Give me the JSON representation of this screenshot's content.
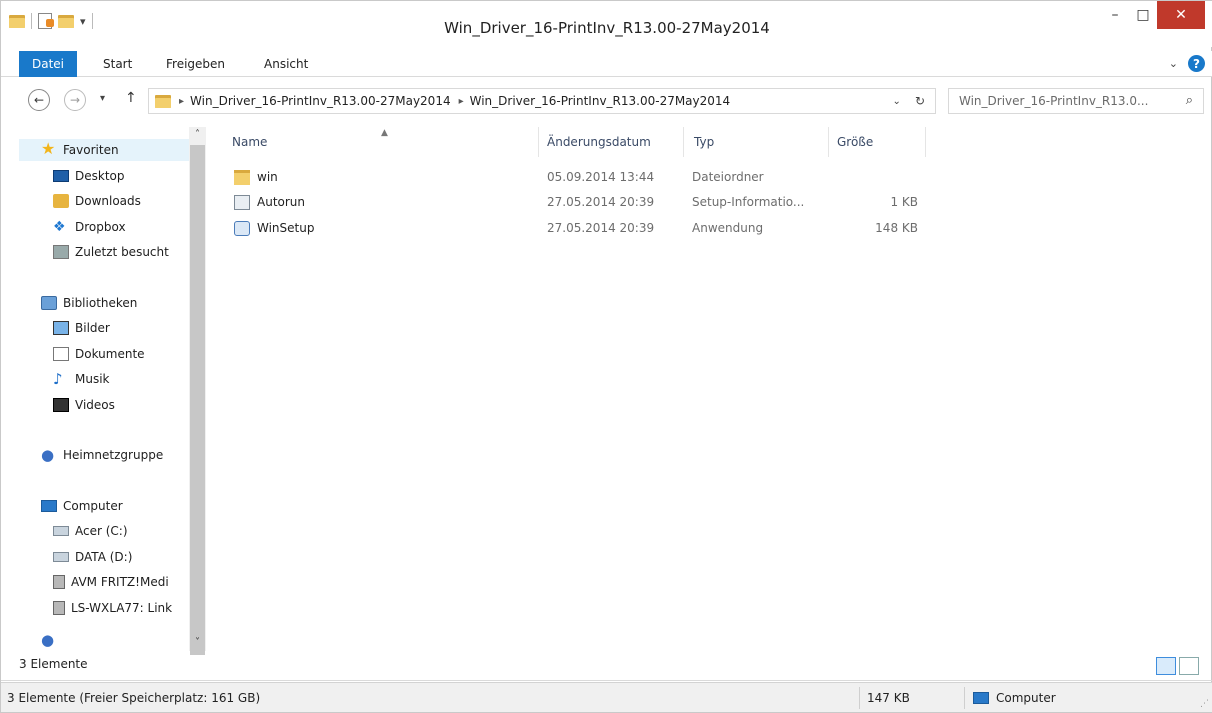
{
  "window": {
    "title": "Win_Driver_16-PrintInv_R13.00-27May2014"
  },
  "ribbon": {
    "tabs": [
      "Datei",
      "Start",
      "Freigeben",
      "Ansicht"
    ]
  },
  "address": {
    "crumbs": [
      "Win_Driver_16-PrintInv_R13.00-27May2014",
      "Win_Driver_16-PrintInv_R13.00-27May2014"
    ]
  },
  "search": {
    "placeholder": "Win_Driver_16-PrintInv_R13.0..."
  },
  "nav": {
    "favorites": "Favoriten",
    "fav_items": [
      "Desktop",
      "Downloads",
      "Dropbox",
      "Zuletzt besucht"
    ],
    "libraries": "Bibliotheken",
    "lib_items": [
      "Bilder",
      "Dokumente",
      "Musik",
      "Videos"
    ],
    "homegroup": "Heimnetzgruppe",
    "computer": "Computer",
    "comp_items": [
      "Acer (C:)",
      "DATA (D:)",
      "AVM FRITZ!Medi",
      "LS-WXLA77: Link"
    ]
  },
  "columns": [
    "Name",
    "Änderungsdatum",
    "Typ",
    "Größe"
  ],
  "files": [
    {
      "name": "win",
      "date": "05.09.2014 13:44",
      "type": "Dateiordner",
      "size": "",
      "icon": "folder-icon"
    },
    {
      "name": "Autorun",
      "date": "27.05.2014 20:39",
      "type": "Setup-Informatio...",
      "size": "1 KB",
      "icon": "setup-info-icon"
    },
    {
      "name": "WinSetup",
      "date": "27.05.2014 20:39",
      "type": "Anwendung",
      "size": "148 KB",
      "icon": "application-icon"
    }
  ],
  "status": {
    "inner": "3 Elemente",
    "bar_left": "3 Elemente (Freier Speicherplatz: 161 GB)",
    "bar_size": "147 KB",
    "bar_location": "Computer"
  },
  "colors": {
    "accent": "#1979ca",
    "close": "#c0392b"
  }
}
